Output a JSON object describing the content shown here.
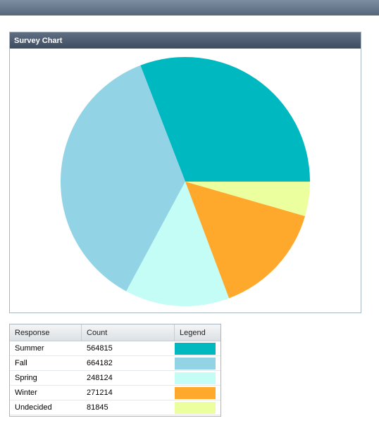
{
  "panel": {
    "title": "Survey Chart"
  },
  "grid": {
    "headers": [
      "Response",
      "Count",
      "Legend"
    ],
    "rows": [
      {
        "response": "Summer",
        "count": "564815"
      },
      {
        "response": "Fall",
        "count": "664182"
      },
      {
        "response": "Spring",
        "count": "248124"
      },
      {
        "response": "Winter",
        "count": "271214"
      },
      {
        "response": "Undecided",
        "count": "81845"
      }
    ]
  },
  "chart_data": {
    "type": "pie",
    "title": "Survey Chart",
    "categories": [
      "Summer",
      "Fall",
      "Spring",
      "Winter",
      "Undecided"
    ],
    "values": [
      564815,
      664182,
      248124,
      271214,
      81845
    ],
    "colors": [
      "#00B8C0",
      "#92D4E6",
      "#C3FDF5",
      "#FFA92C",
      "#ECFF9E"
    ],
    "legend": "table-below"
  }
}
